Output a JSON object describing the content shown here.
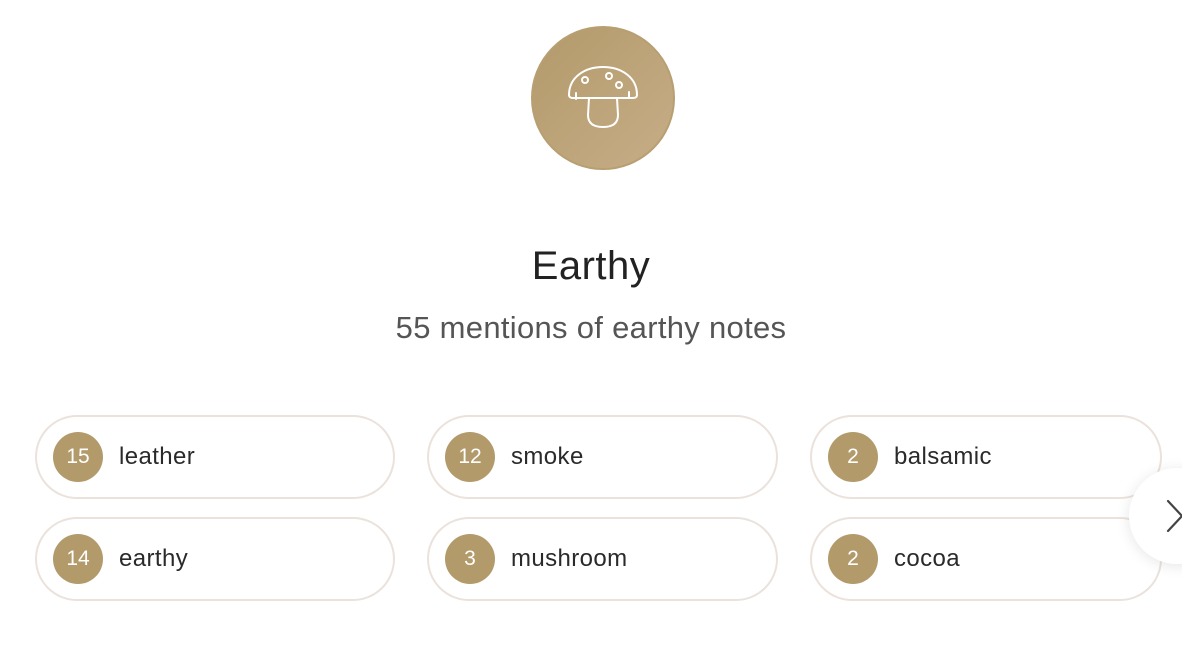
{
  "category": {
    "icon": "mushroom-icon",
    "title": "Earthy",
    "subtitle": "55 mentions of earthy notes"
  },
  "notes": [
    {
      "count": "15",
      "label": "leather"
    },
    {
      "count": "12",
      "label": "smoke"
    },
    {
      "count": "2",
      "label": "balsamic"
    },
    {
      "count": "14",
      "label": "earthy"
    },
    {
      "count": "3",
      "label": "mushroom"
    },
    {
      "count": "2",
      "label": "cocoa"
    }
  ],
  "navigation": {
    "next_icon": "chevron-right-icon"
  },
  "colors": {
    "accent": "#b39a6b",
    "pill_border": "#ebe2dc",
    "title_text": "#222222",
    "subtitle_text": "#555555"
  }
}
